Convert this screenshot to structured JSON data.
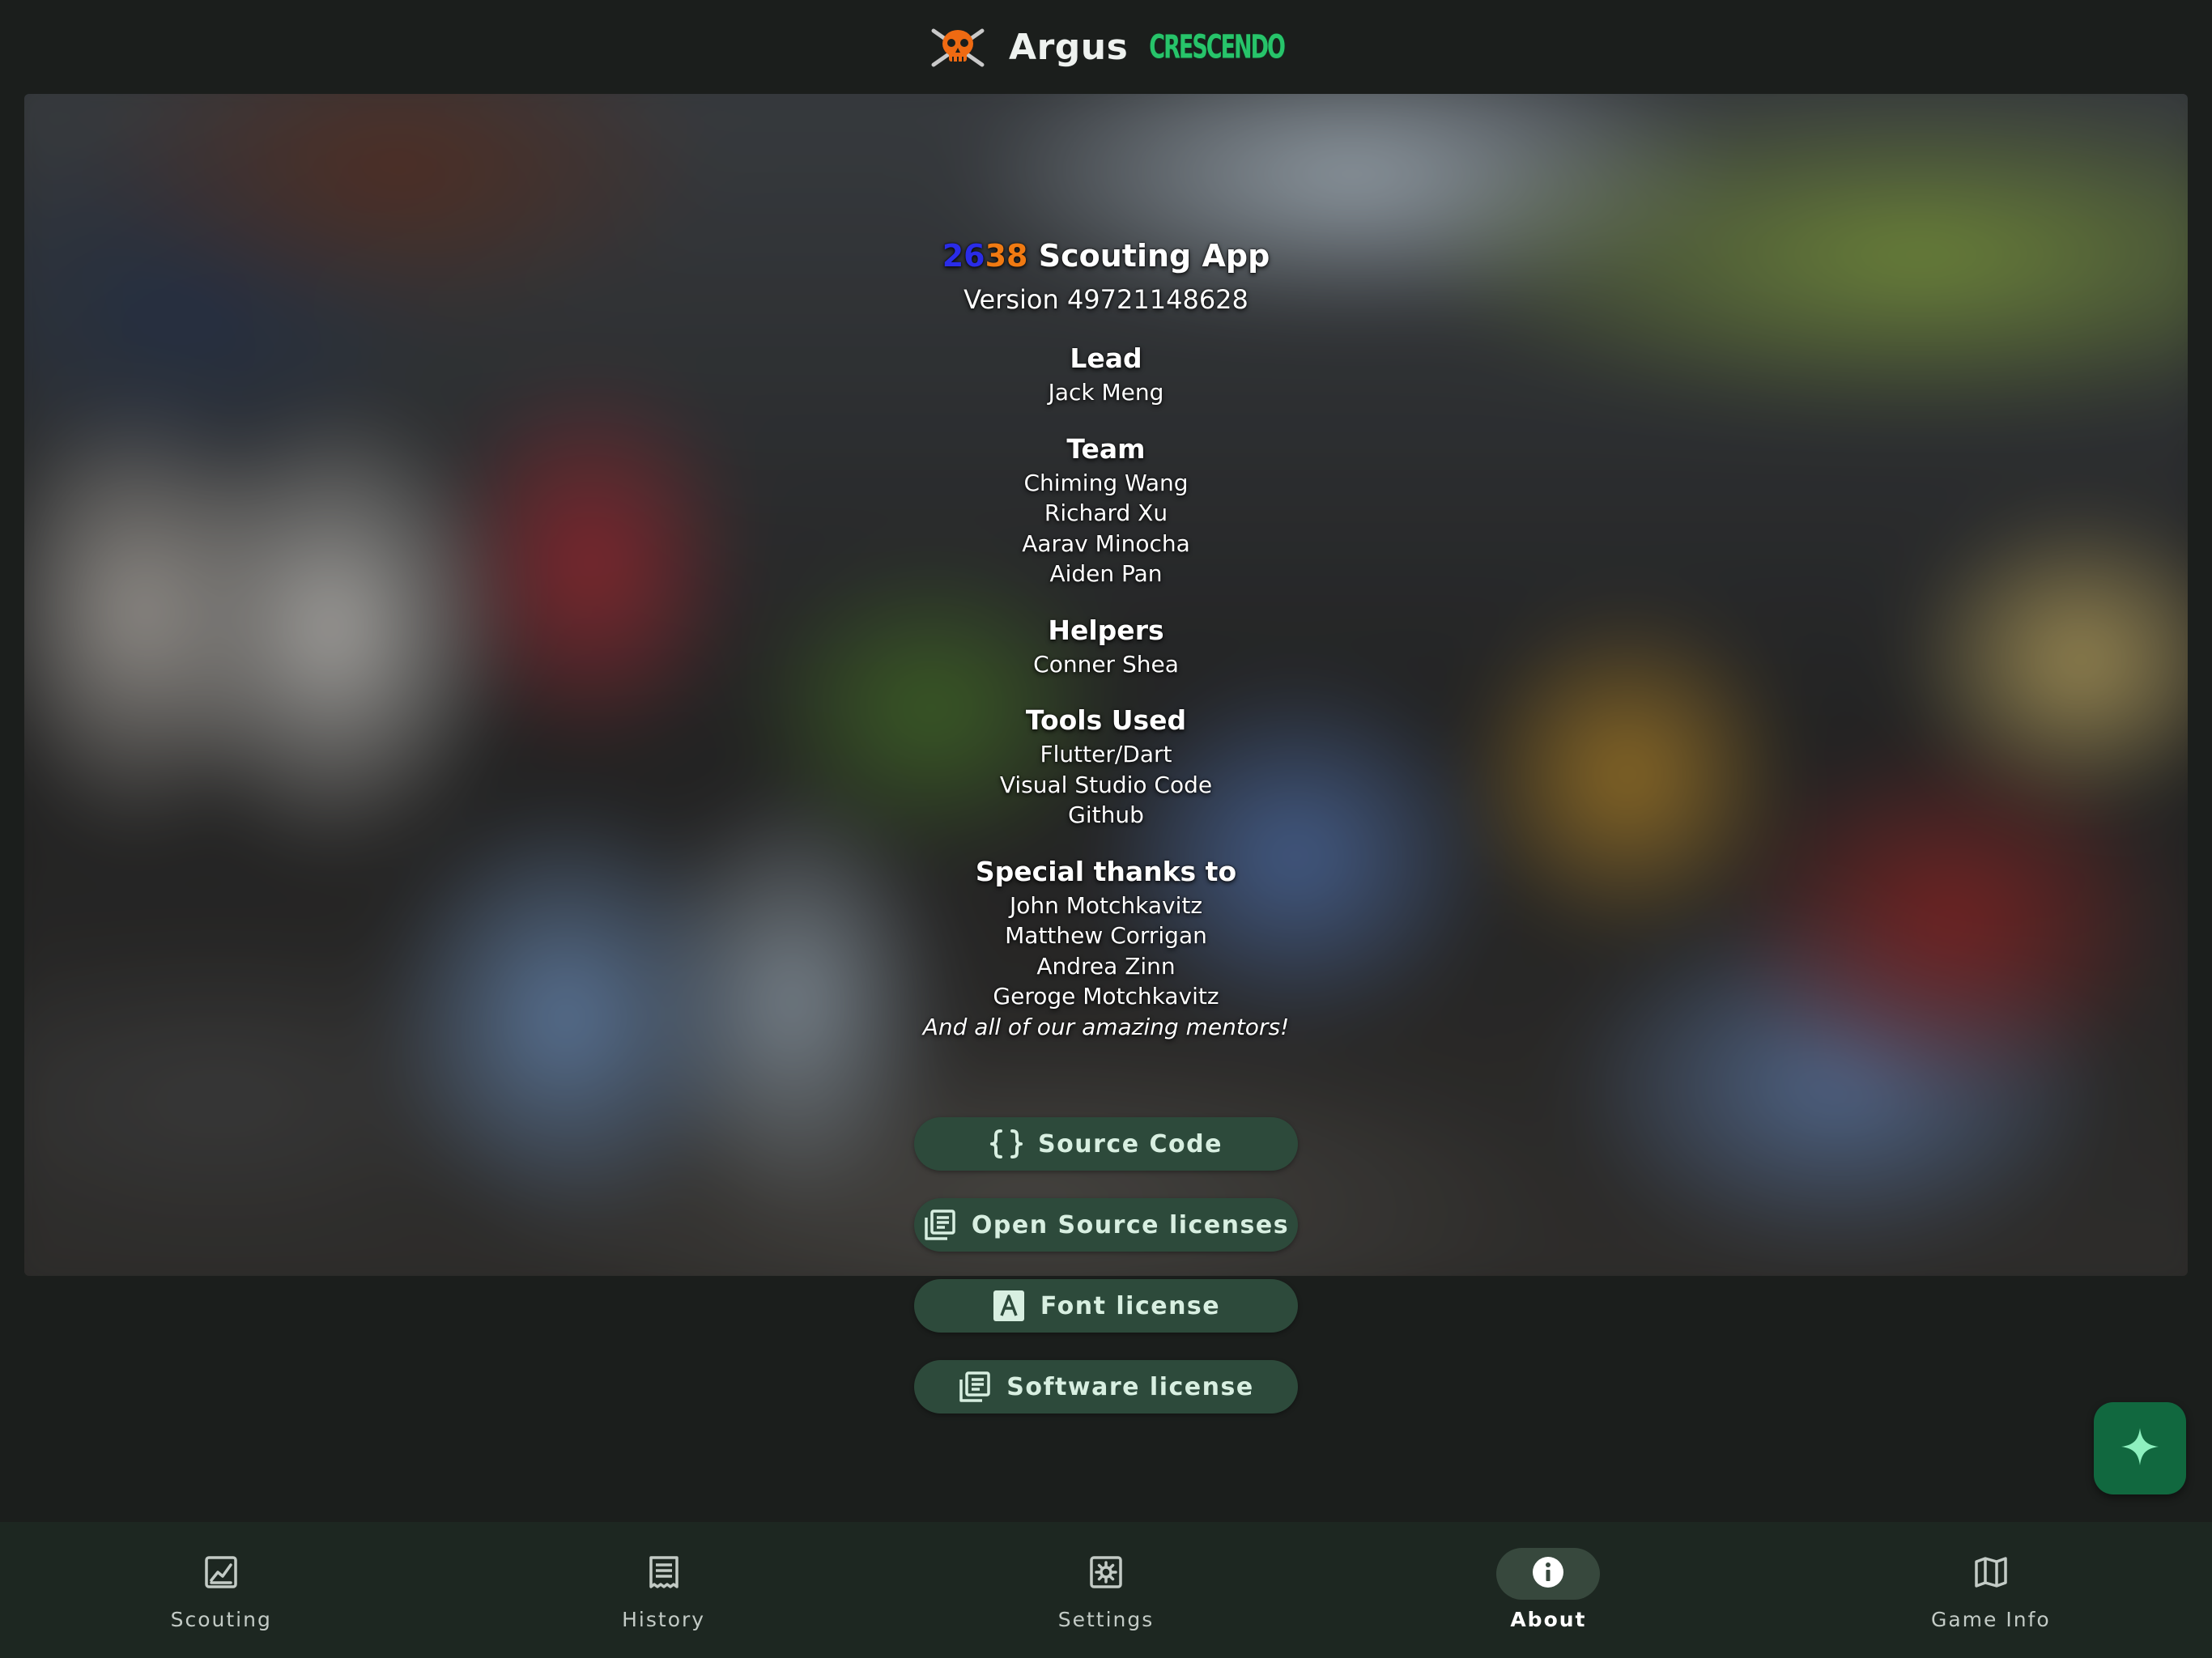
{
  "header": {
    "app_name": "Argus",
    "game_tag": "CRESCENDO",
    "logo_icon": "orange-skull-crossbones-logo-icon"
  },
  "credits": {
    "team_number_part1": "26",
    "team_number_part2": "38",
    "app_title_rest": " Scouting App",
    "version": "Version 49721148628",
    "sections": [
      {
        "title": "Lead",
        "items": [
          "Jack Meng"
        ]
      },
      {
        "title": "Team",
        "items": [
          "Chiming Wang",
          "Richard Xu",
          "Aarav Minocha",
          "Aiden Pan"
        ]
      },
      {
        "title": "Helpers",
        "items": [
          "Conner Shea"
        ]
      },
      {
        "title": "Tools Used",
        "items": [
          "Flutter/Dart",
          "Visual Studio Code",
          "Github"
        ]
      },
      {
        "title": "Special thanks to",
        "items": [
          "John Motchkavitz",
          "Matthew Corrigan",
          "Andrea Zinn",
          "Geroge Motchkavitz"
        ],
        "closing": "And all of our amazing mentors!"
      }
    ]
  },
  "buttons": {
    "source_code": "Source Code",
    "open_source_licenses": "Open Source licenses",
    "font_license": "Font license",
    "software_license": "Software license"
  },
  "fab": {
    "icon": "sparkle-icon"
  },
  "nav": {
    "items": [
      {
        "label": "Scouting",
        "icon": "chart-icon"
      },
      {
        "label": "History",
        "icon": "receipt-list-icon"
      },
      {
        "label": "Settings",
        "icon": "settings-gear-icon"
      },
      {
        "label": "About",
        "icon": "info-icon",
        "active": true
      },
      {
        "label": "Game Info",
        "icon": "map-icon"
      }
    ]
  },
  "colors": {
    "background": "#1b1e1c",
    "button_fill": "#2d4a3b",
    "fab_fill": "#11683f",
    "nav_bar": "#1d2721",
    "active_indicator": "#37483d",
    "team_blue": "#2a2ce8",
    "team_orange": "#f07a12",
    "game_green": "#27c46a"
  }
}
